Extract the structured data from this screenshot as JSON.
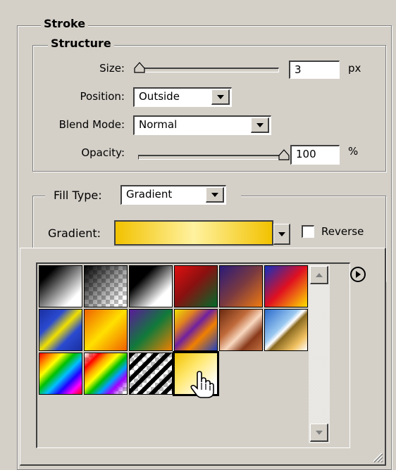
{
  "stroke": {
    "legend": "Stroke",
    "structure": {
      "legend": "Structure",
      "size": {
        "label": "Size:",
        "value": "3",
        "unit": "px",
        "slider_level": 0.03
      },
      "position": {
        "label": "Position:",
        "value": "Outside"
      },
      "blend_mode": {
        "label": "Blend Mode:",
        "value": "Normal"
      },
      "opacity": {
        "label": "Opacity:",
        "value": "100",
        "unit": "%",
        "slider_level": 1.0
      }
    },
    "fill_type": {
      "label": "Fill Type:",
      "value": "Gradient"
    },
    "gradient": {
      "label": "Gradient:",
      "reverse_label": "Reverse",
      "reverse_checked": false
    }
  },
  "gradient_picker": {
    "menu_icon": "right-arrow-circle-icon",
    "swatches": [
      "foreground-to-background",
      "foreground-to-transparent",
      "black-white",
      "red-green",
      "violet-orange",
      "blue-red-yellow",
      "blue-yellow-blue",
      "orange-yellow-orange",
      "violet-green-orange",
      "yellow-violet-orange-blue",
      "copper",
      "chrome",
      "spectrum",
      "transparent-rainbow",
      "transparent-stripes",
      "yellow-to-transparent"
    ],
    "selected_index": 15
  },
  "colors": {
    "panel": "#d4d0c8",
    "shadow": "#404040",
    "highlight": "#ffffff"
  }
}
